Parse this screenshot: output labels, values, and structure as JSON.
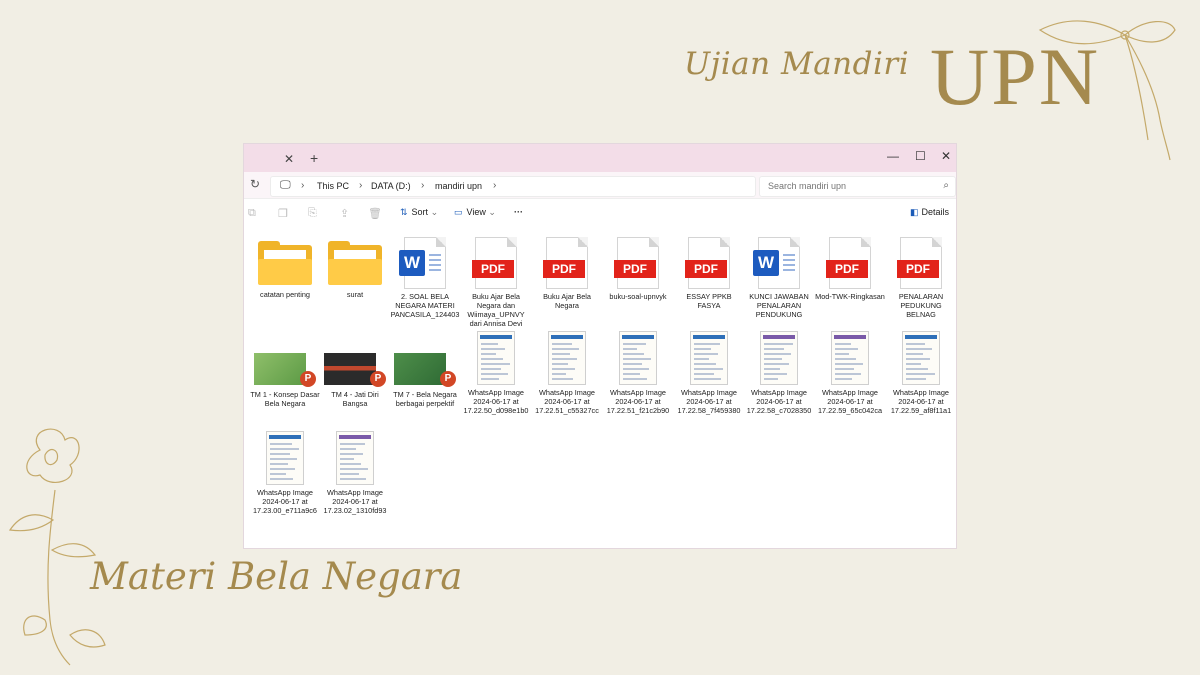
{
  "header": {
    "script_title": "Ujian Mandiri",
    "big_title": "UPN"
  },
  "footer_title": "Materi Bela Negara",
  "colors": {
    "background": "#f1eee4",
    "gold": "#a58a4e",
    "tabbar": "#f3dde8",
    "pdf_red": "#e2231a",
    "word_blue": "#1d5bbf",
    "folder_yellow": "#f0b429"
  },
  "window": {
    "tab": {
      "close_icon": "close-icon",
      "new_icon": "plus-icon"
    },
    "controls": [
      "minimize-icon",
      "maximize-icon",
      "close-icon"
    ],
    "breadcrumb": [
      "This PC",
      "DATA (D:)",
      "mandiri upn"
    ],
    "search_placeholder": "Search mandiri upn",
    "toolbar": {
      "sort_label": "Sort",
      "view_label": "View",
      "more_label": "···",
      "details_label": "Details"
    }
  },
  "files": [
    {
      "type": "folder",
      "name": "catatan penting"
    },
    {
      "type": "folder",
      "name": "surat"
    },
    {
      "type": "word",
      "name": "2. SOAL BELA NEGARA MATERI PANCASILA_124403"
    },
    {
      "type": "pdf",
      "name": "Buku Ajar Bela Negara dan Wiimaya_UPNVY dari Annisa Devi"
    },
    {
      "type": "pdf",
      "name": "Buku Ajar Bela Negara"
    },
    {
      "type": "pdf",
      "name": "buku-soal-upnvyk"
    },
    {
      "type": "pdf",
      "name": "ESSAY PPKB FASYA"
    },
    {
      "type": "word",
      "name": "KUNCI JAWABAN PENALARAN PENDUKUNG"
    },
    {
      "type": "pdf",
      "name": "Mod-TWK-Ringkasan"
    },
    {
      "type": "pdf",
      "name": "PENALARAN PEDUKUNG BELNAG"
    },
    {
      "type": "ppt",
      "name": "TM 1 - Konsep Dasar Bela Negara"
    },
    {
      "type": "ppt",
      "name": "TM 4 - Jati Diri Bangsa"
    },
    {
      "type": "ppt",
      "name": "TM 7 - Bela Negara berbagai perpektif"
    },
    {
      "type": "image",
      "name": "WhatsApp Image 2024-06-17 at 17.22.50_d098e1b0"
    },
    {
      "type": "image",
      "name": "WhatsApp Image 2024-06-17 at 17.22.51_c55327cc"
    },
    {
      "type": "image",
      "name": "WhatsApp Image 2024-06-17 at 17.22.51_f21c2b90"
    },
    {
      "type": "image",
      "name": "WhatsApp Image 2024-06-17 at 17.22.58_7f459380"
    },
    {
      "type": "image",
      "name": "WhatsApp Image 2024-06-17 at 17.22.58_c7028350"
    },
    {
      "type": "image",
      "name": "WhatsApp Image 2024-06-17 at 17.22.59_65c042ca"
    },
    {
      "type": "image",
      "name": "WhatsApp Image 2024-06-17 at 17.22.59_af8f11a1"
    },
    {
      "type": "image",
      "name": "WhatsApp Image 2024-06-17 at 17.23.00_e711a9c6"
    },
    {
      "type": "image",
      "name": "WhatsApp Image 2024-06-17 at 17.23.02_1310fd93"
    }
  ]
}
